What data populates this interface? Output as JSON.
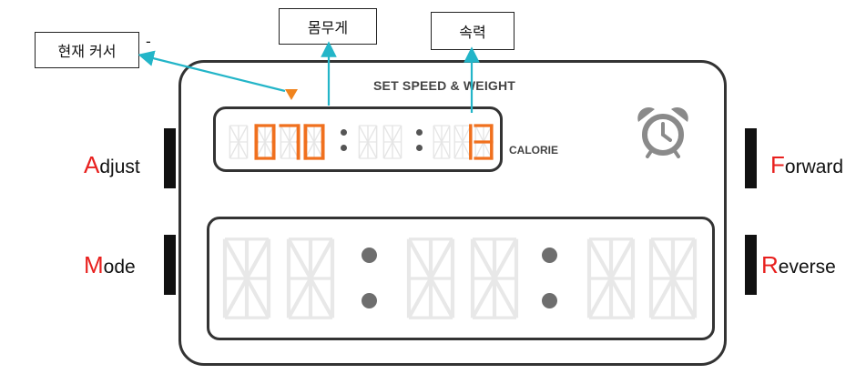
{
  "callouts": {
    "current_cursor": "현재 커서",
    "dash": "-",
    "weight": "몸무게",
    "speed": "속력"
  },
  "panel": {
    "title": "SET SPEED & WEIGHT",
    "calorie_label": "CALORIE"
  },
  "buttons": {
    "adjust": {
      "first": "A",
      "rest": "djust"
    },
    "mode": {
      "first": "M",
      "rest": "ode"
    },
    "forward": {
      "first": "F",
      "rest": "orward"
    },
    "reverse": {
      "first": "R",
      "rest": "everse"
    }
  },
  "upper_display": {
    "weight_digits": "070",
    "middle_digits": "",
    "speed_digits": "13"
  },
  "icons": {
    "alarm": "alarm-clock-icon",
    "cursor": "cursor-triangle-icon"
  },
  "colors": {
    "lit_segment": "#f0701e",
    "label_initial": "#e8201e",
    "arrow": "#23b5c8"
  }
}
